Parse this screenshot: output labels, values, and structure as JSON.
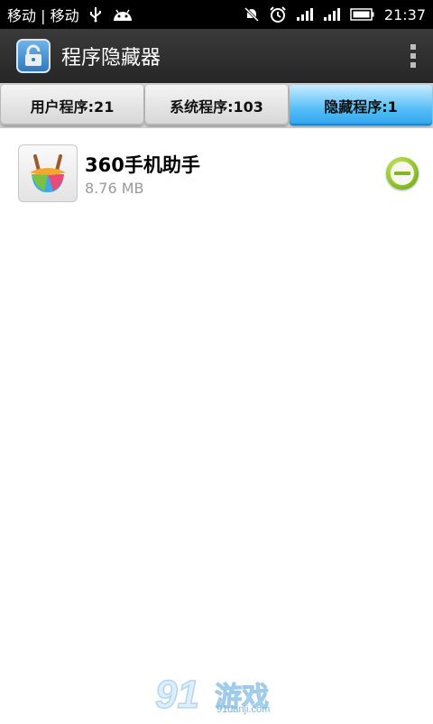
{
  "status_bar": {
    "carrier": "移动 | 移动",
    "time": "21:37",
    "icons": [
      "usb-icon",
      "android-icon",
      "muted-notification-icon",
      "alarm-icon",
      "signal-icon",
      "signal-icon",
      "battery-icon"
    ]
  },
  "action_bar": {
    "title": "程序隐藏器",
    "app_icon": "lock-icon",
    "menu_icon": "overflow-menu-icon"
  },
  "tabs": [
    {
      "label": "用户程序:21",
      "active": false
    },
    {
      "label": "系统程序:103",
      "active": false
    },
    {
      "label": "隐藏程序:1",
      "active": true
    }
  ],
  "apps": [
    {
      "name": "360手机助手",
      "size": "8.76 MB",
      "action_icon": "unhide-icon"
    }
  ],
  "watermark": {
    "main": "91游戏",
    "sub": "91danji.com"
  },
  "colors": {
    "active_tab": "#3fb0f2",
    "action_bar": "#2e2e2e",
    "unhide": "#7fb81f"
  }
}
